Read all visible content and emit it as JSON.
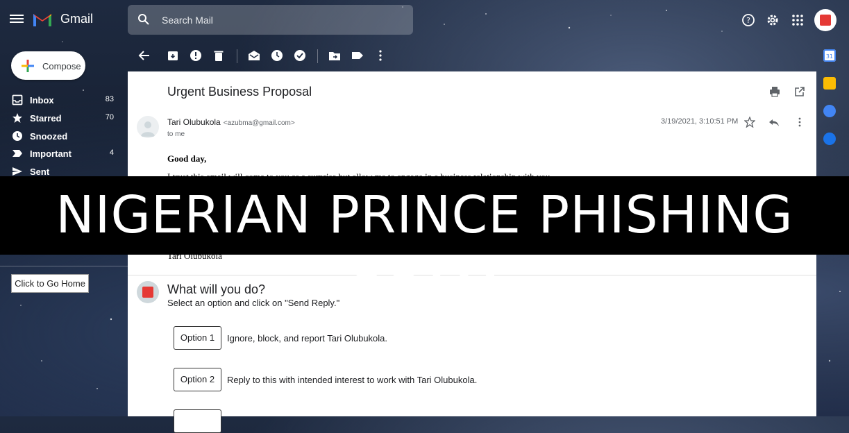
{
  "app": {
    "name": "Gmail"
  },
  "search": {
    "placeholder": "Search Mail"
  },
  "compose": {
    "label": "Compose"
  },
  "sidebar": {
    "items": [
      {
        "label": "Inbox",
        "count": "83"
      },
      {
        "label": "Starred",
        "count": "70"
      },
      {
        "label": "Snoozed",
        "count": ""
      },
      {
        "label": "Important",
        "count": "4"
      },
      {
        "label": "Sent",
        "count": ""
      }
    ],
    "home_button": "Click to Go Home"
  },
  "email": {
    "subject": "Urgent Business Proposal",
    "sender_name": "Tari Olubukola",
    "sender_email": "<azubma@gmail.com>",
    "recipient": "to me",
    "date": "3/19/2021, 3:10:51 PM",
    "greeting": "Good day,",
    "body_line": "I trust this email will come to you as a surprise but allow me to engage in a business relationship with you.",
    "signature": "Tari Olubukola"
  },
  "reply": {
    "title": "What will you do?",
    "subtitle": "Select an option and click on \"Send Reply.\"",
    "options": [
      {
        "button": "Option 1",
        "text": "Ignore, block, and report Tari Olubukola."
      },
      {
        "button": "Option 2",
        "text": "Reply to this with intended interest to work with Tari Olubukola."
      },
      {
        "button": "",
        "text": ""
      }
    ]
  },
  "banner": {
    "text": "NIGERIAN PRINCE PHISHING SCAM"
  },
  "colors": {
    "accent_red": "#e53935",
    "panel": "#ffffff",
    "banner": "#000000"
  }
}
